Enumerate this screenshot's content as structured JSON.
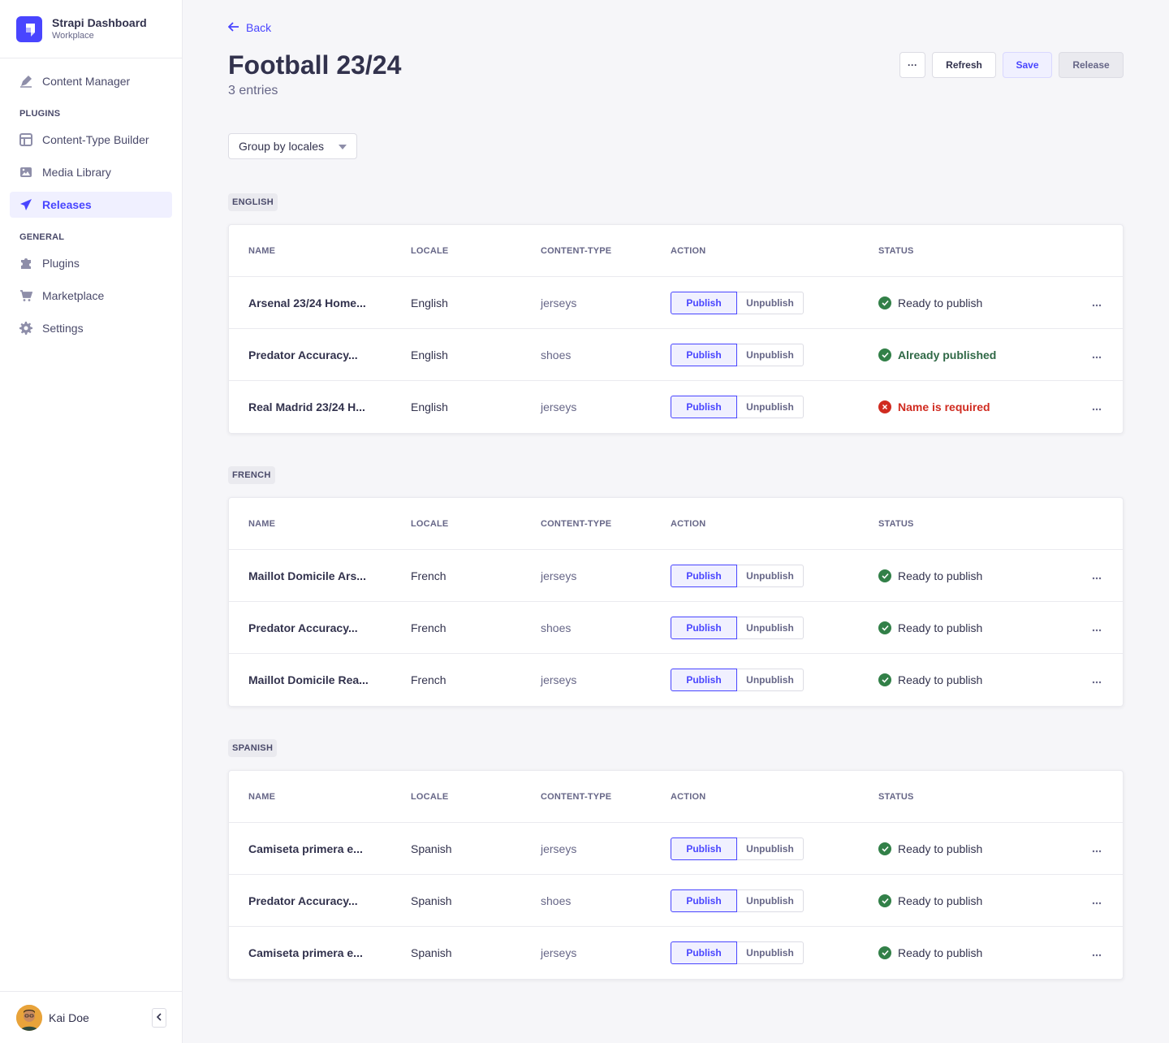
{
  "brand": {
    "title": "Strapi Dashboard",
    "subtitle": "Workplace",
    "color": "#4945ff"
  },
  "sidebar": {
    "items_top": [
      {
        "label": "Content Manager",
        "icon": "feather-icon"
      }
    ],
    "plugins_label": "PLUGINS",
    "plugins": [
      {
        "label": "Content-Type Builder",
        "icon": "layout-icon"
      },
      {
        "label": "Media Library",
        "icon": "image-icon"
      },
      {
        "label": "Releases",
        "icon": "paper-plane-icon",
        "active": true
      }
    ],
    "general_label": "GENERAL",
    "general": [
      {
        "label": "Plugins",
        "icon": "puzzle-icon"
      },
      {
        "label": "Marketplace",
        "icon": "cart-icon"
      },
      {
        "label": "Settings",
        "icon": "gear-icon"
      }
    ],
    "user": {
      "name": "Kai Doe"
    }
  },
  "header": {
    "back_label": "Back",
    "title": "Football 23/24",
    "subtitle": "3 entries",
    "refresh_label": "Refresh",
    "save_label": "Save",
    "release_label": "Release",
    "more_label": "···"
  },
  "group_by": {
    "selected": "Group by locales"
  },
  "table_headers": {
    "name": "NAME",
    "locale": "LOCALE",
    "content_type": "CONTENT-TYPE",
    "action": "ACTION",
    "status": "STATUS"
  },
  "actions": {
    "publish": "Publish",
    "unpublish": "Unpublish"
  },
  "groups": [
    {
      "label": "ENGLISH",
      "rows": [
        {
          "name": "Arsenal 23/24 Home...",
          "locale": "English",
          "content_type": "jerseys",
          "status": "Ready to publish",
          "status_kind": "ready"
        },
        {
          "name": "Predator Accuracy...",
          "locale": "English",
          "content_type": "shoes",
          "status": "Already published",
          "status_kind": "published"
        },
        {
          "name": "Real Madrid 23/24 H...",
          "locale": "English",
          "content_type": "jerseys",
          "status": "Name is required",
          "status_kind": "error"
        }
      ]
    },
    {
      "label": "FRENCH",
      "rows": [
        {
          "name": "Maillot Domicile Ars...",
          "locale": "French",
          "content_type": "jerseys",
          "status": "Ready to publish",
          "status_kind": "ready"
        },
        {
          "name": "Predator Accuracy...",
          "locale": "French",
          "content_type": "shoes",
          "status": "Ready to publish",
          "status_kind": "ready"
        },
        {
          "name": "Maillot Domicile Rea...",
          "locale": "French",
          "content_type": "jerseys",
          "status": "Ready to publish",
          "status_kind": "ready"
        }
      ]
    },
    {
      "label": "SPANISH",
      "rows": [
        {
          "name": "Camiseta primera e...",
          "locale": "Spanish",
          "content_type": "jerseys",
          "status": "Ready to publish",
          "status_kind": "ready"
        },
        {
          "name": "Predator Accuracy...",
          "locale": "Spanish",
          "content_type": "shoes",
          "status": "Ready to publish",
          "status_kind": "ready"
        },
        {
          "name": "Camiseta primera e...",
          "locale": "Spanish",
          "content_type": "jerseys",
          "status": "Ready to publish",
          "status_kind": "ready"
        }
      ]
    }
  ]
}
